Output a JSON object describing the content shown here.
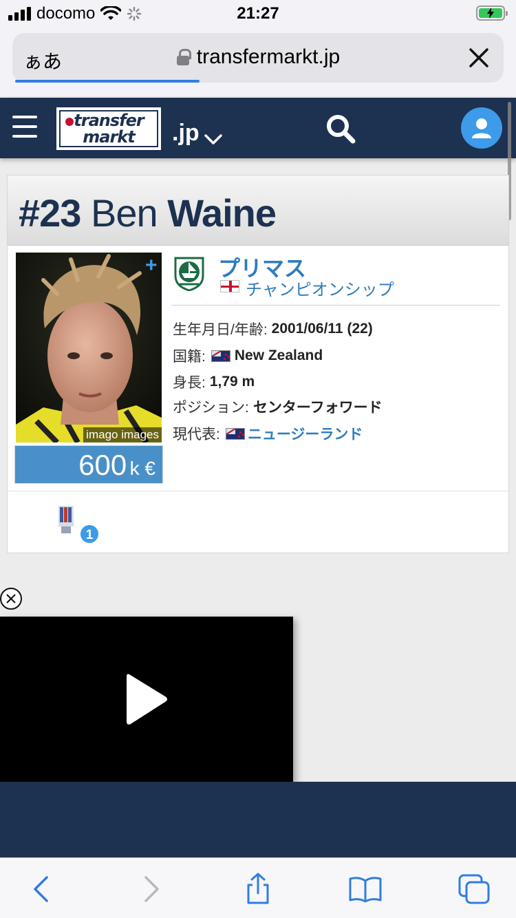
{
  "status_bar": {
    "carrier": "docomo",
    "time": "21:27",
    "battery_charging": true
  },
  "browser": {
    "text_size_label": "ぁあ",
    "url": "transfermarkt.jp",
    "load_progress": 0.38
  },
  "site_header": {
    "logo_line1": "transfer",
    "logo_line2": "markt",
    "domain": ".jp"
  },
  "player": {
    "number": "#23",
    "first_name": "Ben",
    "last_name": "Waine",
    "photo_credit": "imago images",
    "market_value": "600",
    "market_value_unit": "k €",
    "club": "プリマス",
    "league": "チャンピオンシップ",
    "info": {
      "birth_label": "生年月日/年齢:",
      "birth_value": "2001/06/11 (22)",
      "nationality_label": "国籍:",
      "nationality_value": "New Zealand",
      "height_label": "身長:",
      "height_value": "1,79 m",
      "position_label": "ポジション:",
      "position_value": "センターフォワード",
      "national_team_label": "現代表:",
      "national_team_value": "ニュージーランド"
    },
    "badge_count": "1"
  },
  "colors": {
    "header_navy": "#1d3150",
    "link_blue": "#2f7cbd",
    "accent_blue": "#3d9be9",
    "market_value_bg": "#4a90c8"
  }
}
